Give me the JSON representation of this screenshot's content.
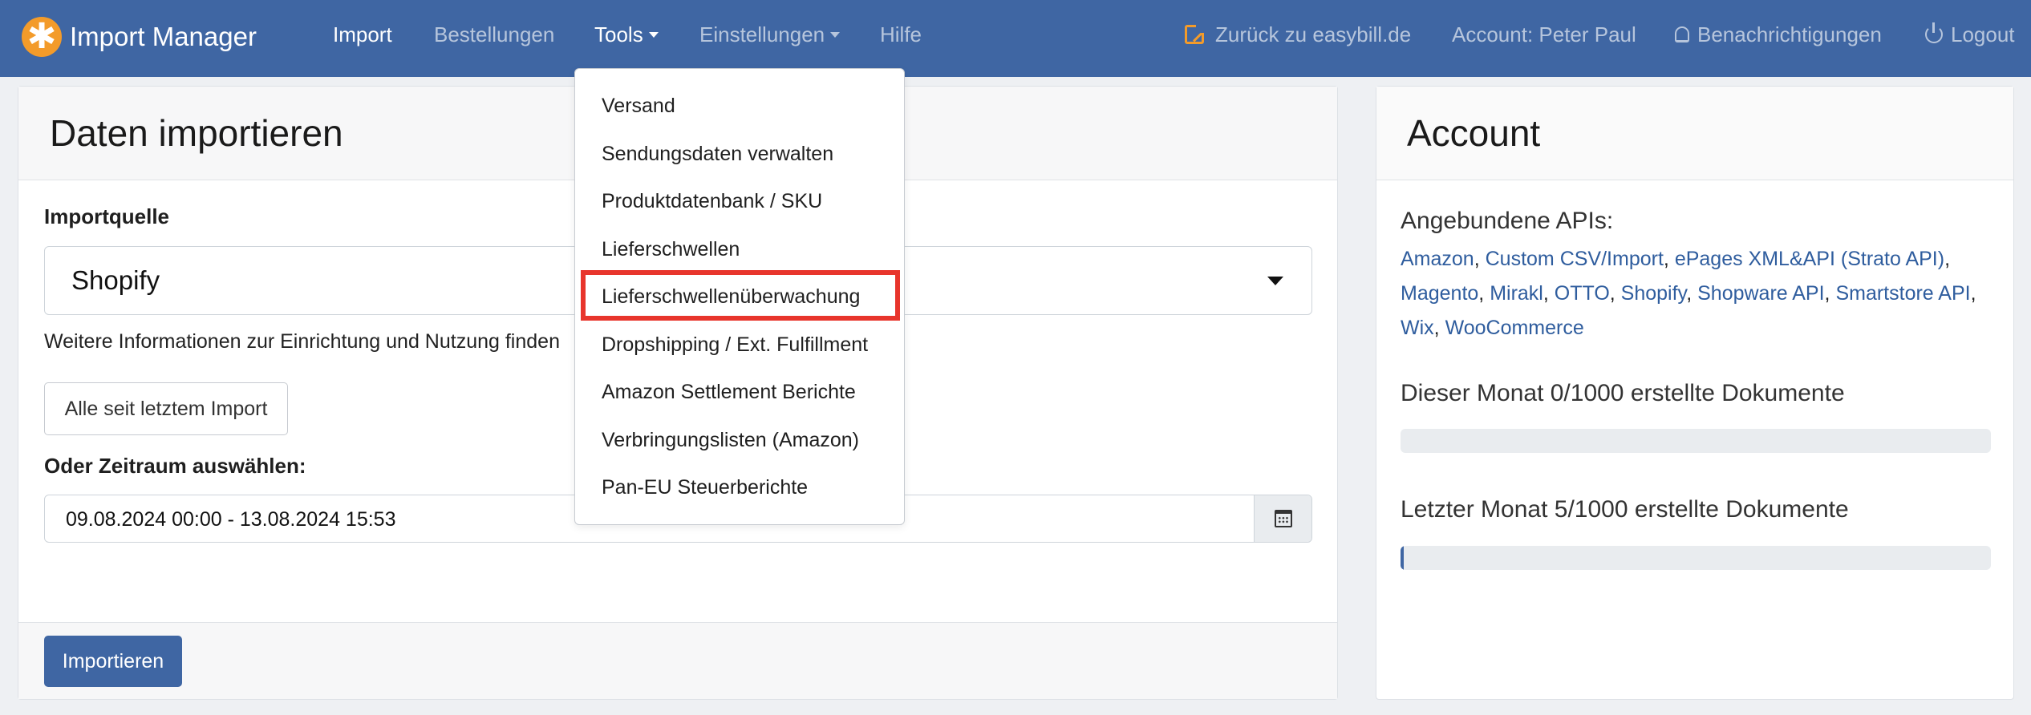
{
  "navbar": {
    "brand": "Import Manager",
    "items": [
      {
        "label": "Import",
        "active": true
      },
      {
        "label": "Bestellungen",
        "active": false
      },
      {
        "label": "Tools",
        "active": true,
        "dropdown": true
      },
      {
        "label": "Einstellungen",
        "active": false,
        "dropdown": true
      },
      {
        "label": "Hilfe",
        "active": false
      }
    ],
    "right": {
      "back_link": "Zurück zu easybill.de",
      "account": "Account: Peter Paul",
      "notifications": "Benachrichtigungen",
      "logout": "Logout"
    }
  },
  "tools_menu": {
    "items": [
      "Versand",
      "Sendungsdaten verwalten",
      "Produktdatenbank / SKU",
      "Lieferschwellen",
      "Lieferschwellenüberwachung",
      "Dropshipping / Ext. Fulfillment",
      "Amazon Settlement Berichte",
      "Verbringungslisten (Amazon)",
      "Pan-EU Steuerberichte"
    ],
    "highlighted_index": 4,
    "highlight_color": "#e8352c"
  },
  "import_card": {
    "title": "Daten importieren",
    "source_label": "Importquelle",
    "source_value": "Shopify",
    "help_text": "Weitere Informationen zur Einrichtung und Nutzung finden",
    "since_last_button": "Alle seit letztem Import",
    "period_label": "Oder Zeitraum auswählen:",
    "period_value": "09.08.2024 00:00 - 13.08.2024 15:53",
    "submit_button": "Importieren"
  },
  "account_card": {
    "title": "Account",
    "apis_label": "Angebundene APIs:",
    "apis": [
      "Amazon",
      "Custom CSV/Import",
      "ePages XML&API (Strato API)",
      "Magento",
      "Mirakl",
      "OTTO",
      "Shopify",
      "Shopware API",
      "Smartstore API",
      "Wix",
      "WooCommerce"
    ],
    "this_month": {
      "label": "Dieser Monat 0/1000 erstellte Dokumente",
      "fraction": 0.0
    },
    "last_month": {
      "label": "Letzter Monat 5/1000 erstellte Dokumente",
      "fraction": 0.005
    }
  },
  "colors": {
    "navbar": "#3f66a3",
    "accent": "#f39b2a",
    "link": "#2f5d9e"
  }
}
